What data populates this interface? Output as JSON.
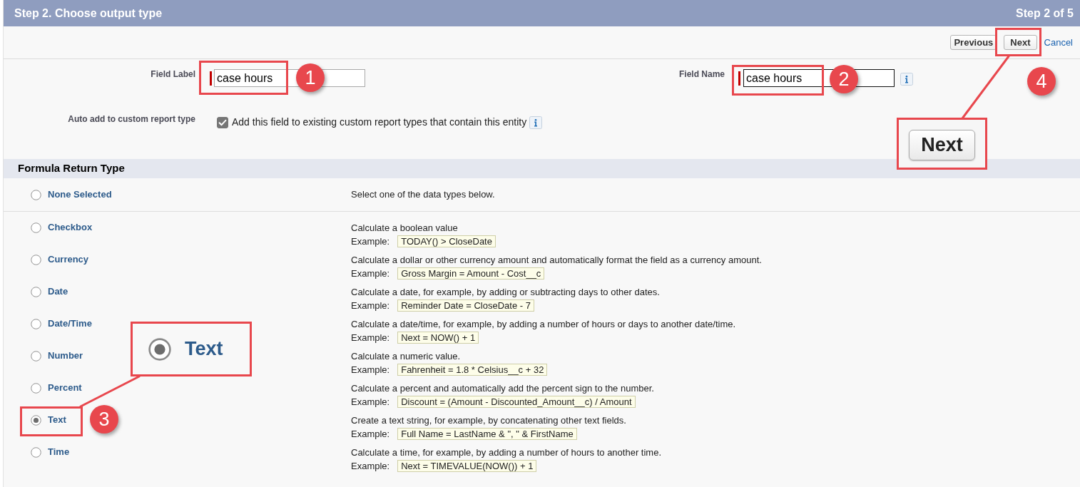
{
  "header": {
    "title": "Step 2. Choose output type",
    "step": "Step 2 of 5"
  },
  "toolbar": [
    {
      "kind": "button",
      "label": "Previous"
    },
    {
      "kind": "button",
      "label": "Next"
    },
    {
      "kind": "link",
      "label": "Cancel"
    }
  ],
  "fields": [
    {
      "label": "Field Label",
      "value": "case hours",
      "required": true,
      "focused": false,
      "info": false
    },
    {
      "label": "Field Name",
      "value": "case hours",
      "required": true,
      "focused": true,
      "info": true
    }
  ],
  "auto_add": {
    "label": "Auto add to custom report type",
    "checked": true,
    "text": "Add this field to existing custom report types that contain this entity",
    "info": true
  },
  "return_type": {
    "title": "Formula Return Type",
    "options": [
      {
        "kind": "none",
        "label": "None Selected",
        "selected": false,
        "description": "Select one of the data types below."
      },
      {
        "kind": "type",
        "label": "Checkbox",
        "selected": false,
        "description": "Calculate a boolean value",
        "example_label": "Example:",
        "example": "TODAY() > CloseDate"
      },
      {
        "kind": "type",
        "label": "Currency",
        "selected": false,
        "description": "Calculate a dollar or other currency amount and automatically format the field as a currency amount.",
        "example_label": "Example:",
        "example": "Gross Margin = Amount - Cost__c"
      },
      {
        "kind": "type",
        "label": "Date",
        "selected": false,
        "description": "Calculate a date, for example, by adding or subtracting days to other dates.",
        "example_label": "Example:",
        "example": "Reminder Date = CloseDate - 7"
      },
      {
        "kind": "type",
        "label": "Date/Time",
        "selected": false,
        "description": "Calculate a date/time, for example, by adding a number of hours or days to another date/time.",
        "example_label": "Example:",
        "example": "Next = NOW() + 1"
      },
      {
        "kind": "type",
        "label": "Number",
        "selected": false,
        "description": "Calculate a numeric value.",
        "example_label": "Example:",
        "example": "Fahrenheit = 1.8 * Celsius__c + 32"
      },
      {
        "kind": "type",
        "label": "Percent",
        "selected": false,
        "description": "Calculate a percent and automatically add the percent sign to the number.",
        "example_label": "Example:",
        "example": "Discount = (Amount - Discounted_Amount__c) / Amount"
      },
      {
        "kind": "type",
        "label": "Text",
        "selected": true,
        "description": "Create a text string, for example, by concatenating other text fields.",
        "example_label": "Example:",
        "example": "Full Name = LastName & \", \" & FirstName"
      },
      {
        "kind": "type",
        "label": "Time",
        "selected": false,
        "description": "Calculate a time, for example, by adding a number of hours to another time.",
        "example_label": "Example:",
        "example": "Next = TIMEVALUE(NOW()) + 1"
      }
    ]
  },
  "annotations": {
    "badges": [
      "1",
      "2",
      "3",
      "4"
    ],
    "insets": [
      {
        "kind": "radio",
        "label": "Text",
        "selected": true
      },
      {
        "kind": "button",
        "label": "Next"
      }
    ]
  }
}
